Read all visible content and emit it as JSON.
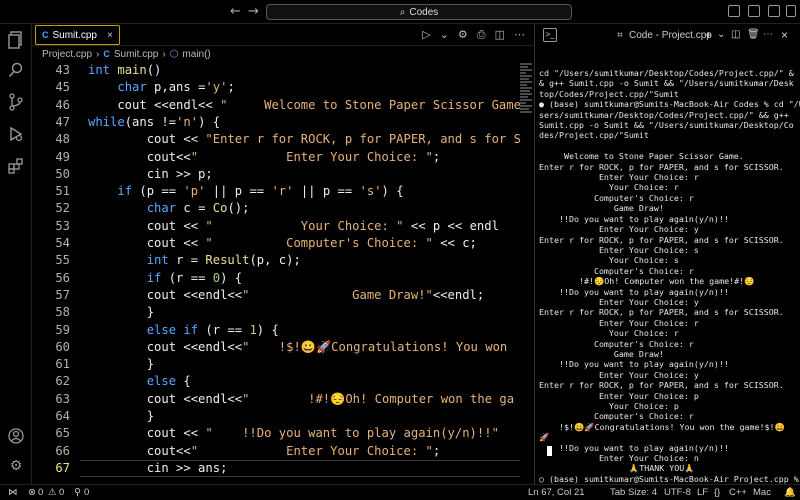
{
  "window": {
    "search_text": "Codes"
  },
  "editor": {
    "tab_label": "Sumit.cpp",
    "breadcrumb": [
      "Project.cpp",
      "Sumit.cpp",
      "main()"
    ],
    "lines": [
      {
        "n": "43",
        "segs": [
          [
            "int ",
            "kw"
          ],
          [
            "main",
            "fn"
          ],
          [
            "()",
            ""
          ]
        ]
      },
      {
        "n": "45",
        "segs": [
          [
            "    ",
            ""
          ],
          [
            "char ",
            "kw"
          ],
          [
            "p,ans =",
            ""
          ],
          [
            "'y'",
            "str"
          ],
          [
            ";",
            ""
          ]
        ]
      },
      {
        "n": "46",
        "segs": [
          [
            "    cout <<endl<< ",
            ""
          ],
          [
            "\"     Welcome to Stone Paper Scissor Game",
            "str"
          ]
        ]
      },
      {
        "n": "47",
        "segs": [
          [
            "",
            ""
          ],
          [
            "while",
            "kw"
          ],
          [
            "(ans !=",
            ""
          ],
          [
            "'n'",
            "str"
          ],
          [
            ") {",
            ""
          ]
        ]
      },
      {
        "n": "48",
        "segs": [
          [
            "        cout << ",
            ""
          ],
          [
            "\"Enter r for ROCK, p for PAPER, and s for S",
            "str"
          ]
        ]
      },
      {
        "n": "49",
        "segs": [
          [
            "        cout<<",
            ""
          ],
          [
            "\"            Enter Your Choice: \"",
            "str"
          ],
          [
            ";",
            ""
          ]
        ]
      },
      {
        "n": "50",
        "segs": [
          [
            "        cin >> p;",
            ""
          ]
        ]
      },
      {
        "n": "51",
        "segs": [
          [
            "    ",
            ""
          ],
          [
            "if ",
            "kw"
          ],
          [
            "(p == ",
            ""
          ],
          [
            "'p'",
            "str"
          ],
          [
            " || p == ",
            ""
          ],
          [
            "'r'",
            "str"
          ],
          [
            " || p == ",
            ""
          ],
          [
            "'s'",
            "str"
          ],
          [
            ") {",
            ""
          ]
        ]
      },
      {
        "n": "52",
        "segs": [
          [
            "        ",
            ""
          ],
          [
            "char ",
            "kw"
          ],
          [
            "c = ",
            ""
          ],
          [
            "Co",
            "fn"
          ],
          [
            "();",
            ""
          ]
        ]
      },
      {
        "n": "53",
        "segs": [
          [
            "        cout << ",
            ""
          ],
          [
            "\"            Your Choice: \"",
            "str"
          ],
          [
            " << p << endl",
            ""
          ]
        ]
      },
      {
        "n": "54",
        "segs": [
          [
            "        cout << ",
            ""
          ],
          [
            "\"          Computer's Choice: \"",
            "str"
          ],
          [
            " << c;",
            ""
          ]
        ]
      },
      {
        "n": "55",
        "segs": [
          [
            "        ",
            ""
          ],
          [
            "int ",
            "kw"
          ],
          [
            "r = ",
            ""
          ],
          [
            "Result",
            "fn"
          ],
          [
            "(p, c);",
            ""
          ]
        ]
      },
      {
        "n": "56",
        "segs": [
          [
            "        ",
            ""
          ],
          [
            "if ",
            "kw"
          ],
          [
            "(r == ",
            ""
          ],
          [
            "0",
            "num"
          ],
          [
            ") {",
            ""
          ]
        ]
      },
      {
        "n": "57",
        "segs": [
          [
            "        cout <<endl<<",
            ""
          ],
          [
            "\"              Game Draw!\"",
            "str"
          ],
          [
            "<<endl;",
            ""
          ]
        ]
      },
      {
        "n": "58",
        "segs": [
          [
            "        }",
            ""
          ]
        ]
      },
      {
        "n": "59",
        "segs": [
          [
            "        ",
            ""
          ],
          [
            "else if ",
            "kw"
          ],
          [
            "(r == ",
            ""
          ],
          [
            "1",
            "num"
          ],
          [
            ") {",
            ""
          ]
        ]
      },
      {
        "n": "60",
        "segs": [
          [
            "        cout <<endl<<",
            ""
          ],
          [
            "\"    !$!😀🚀Congratulations! You won",
            "str"
          ]
        ]
      },
      {
        "n": "61",
        "segs": [
          [
            "        }",
            ""
          ]
        ]
      },
      {
        "n": "62",
        "segs": [
          [
            "        ",
            ""
          ],
          [
            "else ",
            "kw"
          ],
          [
            "{",
            ""
          ]
        ]
      },
      {
        "n": "63",
        "segs": [
          [
            "        cout <<endl<<",
            ""
          ],
          [
            "\"        !#!😔Oh! Computer won the ga",
            "str"
          ]
        ]
      },
      {
        "n": "64",
        "segs": [
          [
            "        }",
            ""
          ]
        ]
      },
      {
        "n": "65",
        "segs": [
          [
            "        cout << ",
            ""
          ],
          [
            "\"    !!Do you want to play again(y/n)!!\"",
            "str"
          ]
        ]
      },
      {
        "n": "66",
        "segs": [
          [
            "        cout<<",
            ""
          ],
          [
            "\"            Enter Your Choice: \"",
            "str"
          ],
          [
            ";",
            ""
          ]
        ]
      },
      {
        "n": "67",
        "segs": [
          [
            "        cin >> ans;",
            ""
          ]
        ]
      }
    ]
  },
  "terminal": {
    "tab_title": "Code - Project.cpp",
    "output": "cd \"/Users/sumitkumar/Desktop/Codes/Project.cpp/\" &\n& g++ Sumit.cpp -o Sumit && \"/Users/sumitkumar/Desk\ntop/Codes/Project.cpp/\"Sumit\n● (base) sumitkumar@Sumits-MacBook-Air Codes % cd \"/U\nsers/sumitkumar/Desktop/Codes/Project.cpp/\" && g++\nSumit.cpp -o Sumit && \"/Users/sumitkumar/Desktop/Co\ndes/Project.cpp/\"Sumit\n\n     Welcome to Stone Paper Scissor Game.\nEnter r for ROCK, p for PAPER, and s for SCISSOR.\n            Enter Your Choice: r\n              Your Choice: r\n           Computer's Choice: r\n               Game Draw!\n    !!Do you want to play again(y/n)!!\n            Enter Your Choice: y\nEnter r for ROCK, p for PAPER, and s for SCISSOR.\n            Enter Your Choice: s\n              Your Choice: s\n           Computer's Choice: r\n        !#!😔Oh! Computer won the game!#!😔\n    !!Do you want to play again(y/n)!!\n            Enter Your Choice: y\nEnter r for ROCK, p for PAPER, and s for SCISSOR.\n            Enter Your Choice: r\n              Your Choice: r\n           Computer's Choice: r\n               Game Draw!\n    !!Do you want to play again(y/n)!!\n            Enter Your Choice: y\nEnter r for ROCK, p for PAPER, and s for SCISSOR.\n            Enter Your Choice: p\n              Your Choice: p\n           Computer's Choice: r\n    !$!😀🚀Congratulations! You won the game!$!😀\n🚀\n    !!Do you want to play again(y/n)!!\n            Enter Your Choice: n\n                  🙏THANK YOU🙏\n○ (base) sumitkumar@Sumits-MacBook-Air Project.cpp %"
  },
  "statusbar": {
    "errors": "0",
    "warnings": "0",
    "ports": "0",
    "position": "Ln 67, Col 21",
    "tab_size": "Tab Size: 4",
    "encoding": "UTF-8",
    "eol": "LF",
    "language": "C++",
    "platform": "Mac"
  }
}
